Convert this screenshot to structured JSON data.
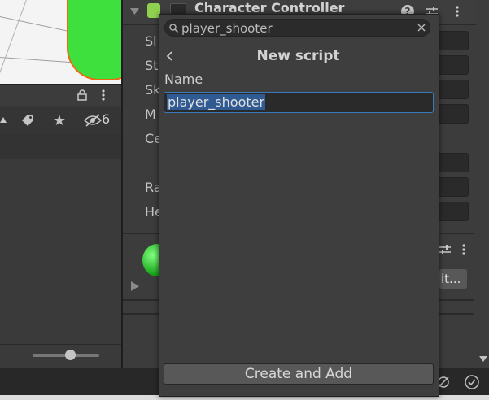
{
  "popup": {
    "search_value": "player_shooter",
    "title": "New script",
    "name_label": "Name",
    "name_value": "player_shooter",
    "create_button_label": "Create and Add"
  },
  "inspector": {
    "component_title": "Character Controller",
    "field_labels": [
      "Sl",
      "St",
      "Sk",
      "M",
      "Ce",
      "Ra",
      "He"
    ],
    "edit_button_label": "it..."
  },
  "project": {
    "hidden_count": "6"
  },
  "colors": {
    "selection": "#2f5b92",
    "input_focus_border": "#3a79bb",
    "capsule": "#3ee03e",
    "capsule_outline": "#f06a10"
  },
  "icons": {
    "search": "search-icon",
    "clear": "close-icon",
    "back": "chevron-left-icon",
    "lock": "lock-icon",
    "menu": "kebab-menu-icon",
    "label": "tag-icon",
    "favorite": "star-icon",
    "hidden": "eye-slash-icon"
  }
}
